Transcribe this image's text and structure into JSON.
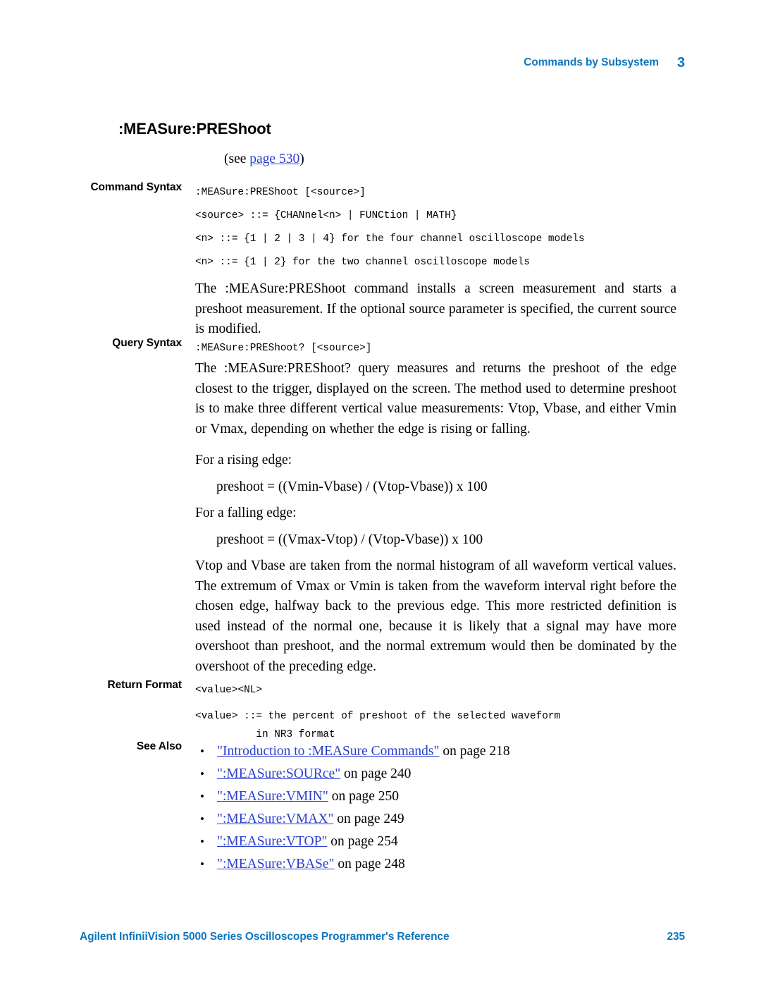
{
  "header": {
    "chapter_title": "Commands by Subsystem",
    "chapter_number": "3"
  },
  "command": {
    "title": ":MEASure:PREShoot",
    "see_prefix": "(see ",
    "see_link": "page 530",
    "see_suffix": ")"
  },
  "sections": {
    "command_syntax": {
      "label": "Command Syntax",
      "code_lines": [
        ":MEASure:PREShoot [<source>]",
        "<source> ::= {CHANnel<n> | FUNCtion | MATH}",
        "<n> ::= {1 | 2 | 3 | 4} for the four channel oscilloscope models",
        "<n> ::= {1 | 2} for the two channel oscilloscope models"
      ],
      "description": "The :MEASure:PREShoot command installs a screen measurement and starts a preshoot measurement. If the optional source parameter is specified, the current source is modified."
    },
    "query_syntax": {
      "label": "Query Syntax",
      "code_lines": [
        ":MEASure:PREShoot? [<source>]"
      ],
      "description": "The :MEASure:PREShoot? query measures and returns the preshoot of the edge closest to the trigger, displayed on the screen. The method used to determine preshoot is to make three different vertical value measurements: Vtop, Vbase, and either Vmin or Vmax, depending on whether the edge is rising or falling.",
      "rising_heading": "For a rising edge:",
      "rising_formula": "preshoot = ((Vmin-Vbase) / (Vtop-Vbase)) x 100",
      "falling_heading": "For a falling edge:",
      "falling_formula": "preshoot = ((Vmax-Vtop) / (Vtop-Vbase)) x 100",
      "notes": "Vtop and Vbase are taken from the normal histogram of all waveform vertical values. The extremum of Vmax or Vmin is taken from the waveform interval right before the chosen edge, halfway back to the previous edge. This more restricted definition is used instead of the normal one, because it is likely that a signal may have more overshoot than preshoot, and the normal extremum would then be dominated by the overshoot of the preceding edge."
    },
    "return_format": {
      "label": "Return Format",
      "code_lines": [
        "<value><NL>",
        "<value> ::= the percent of preshoot of the selected waveform\n          in NR3 format"
      ]
    },
    "see_also": {
      "label": "See Also",
      "bullet": "•",
      "items": [
        {
          "link": "\"Introduction to :MEASure Commands\"",
          "tail": " on page 218"
        },
        {
          "link": "\":MEASure:SOURce\"",
          "tail": " on page 240"
        },
        {
          "link": "\":MEASure:VMIN\"",
          "tail": " on page 250"
        },
        {
          "link": "\":MEASure:VMAX\"",
          "tail": " on page 249"
        },
        {
          "link": "\":MEASure:VTOP\"",
          "tail": " on page 254"
        },
        {
          "link": "\":MEASure:VBASe\"",
          "tail": " on page 248"
        }
      ]
    }
  },
  "footer": {
    "title": "Agilent InfiniiVision 5000 Series Oscilloscopes Programmer's Reference",
    "page_number": "235"
  },
  "colors": {
    "brand_blue": "#0d76bd",
    "link_blue": "#2b3fd0",
    "text": "#000000"
  }
}
